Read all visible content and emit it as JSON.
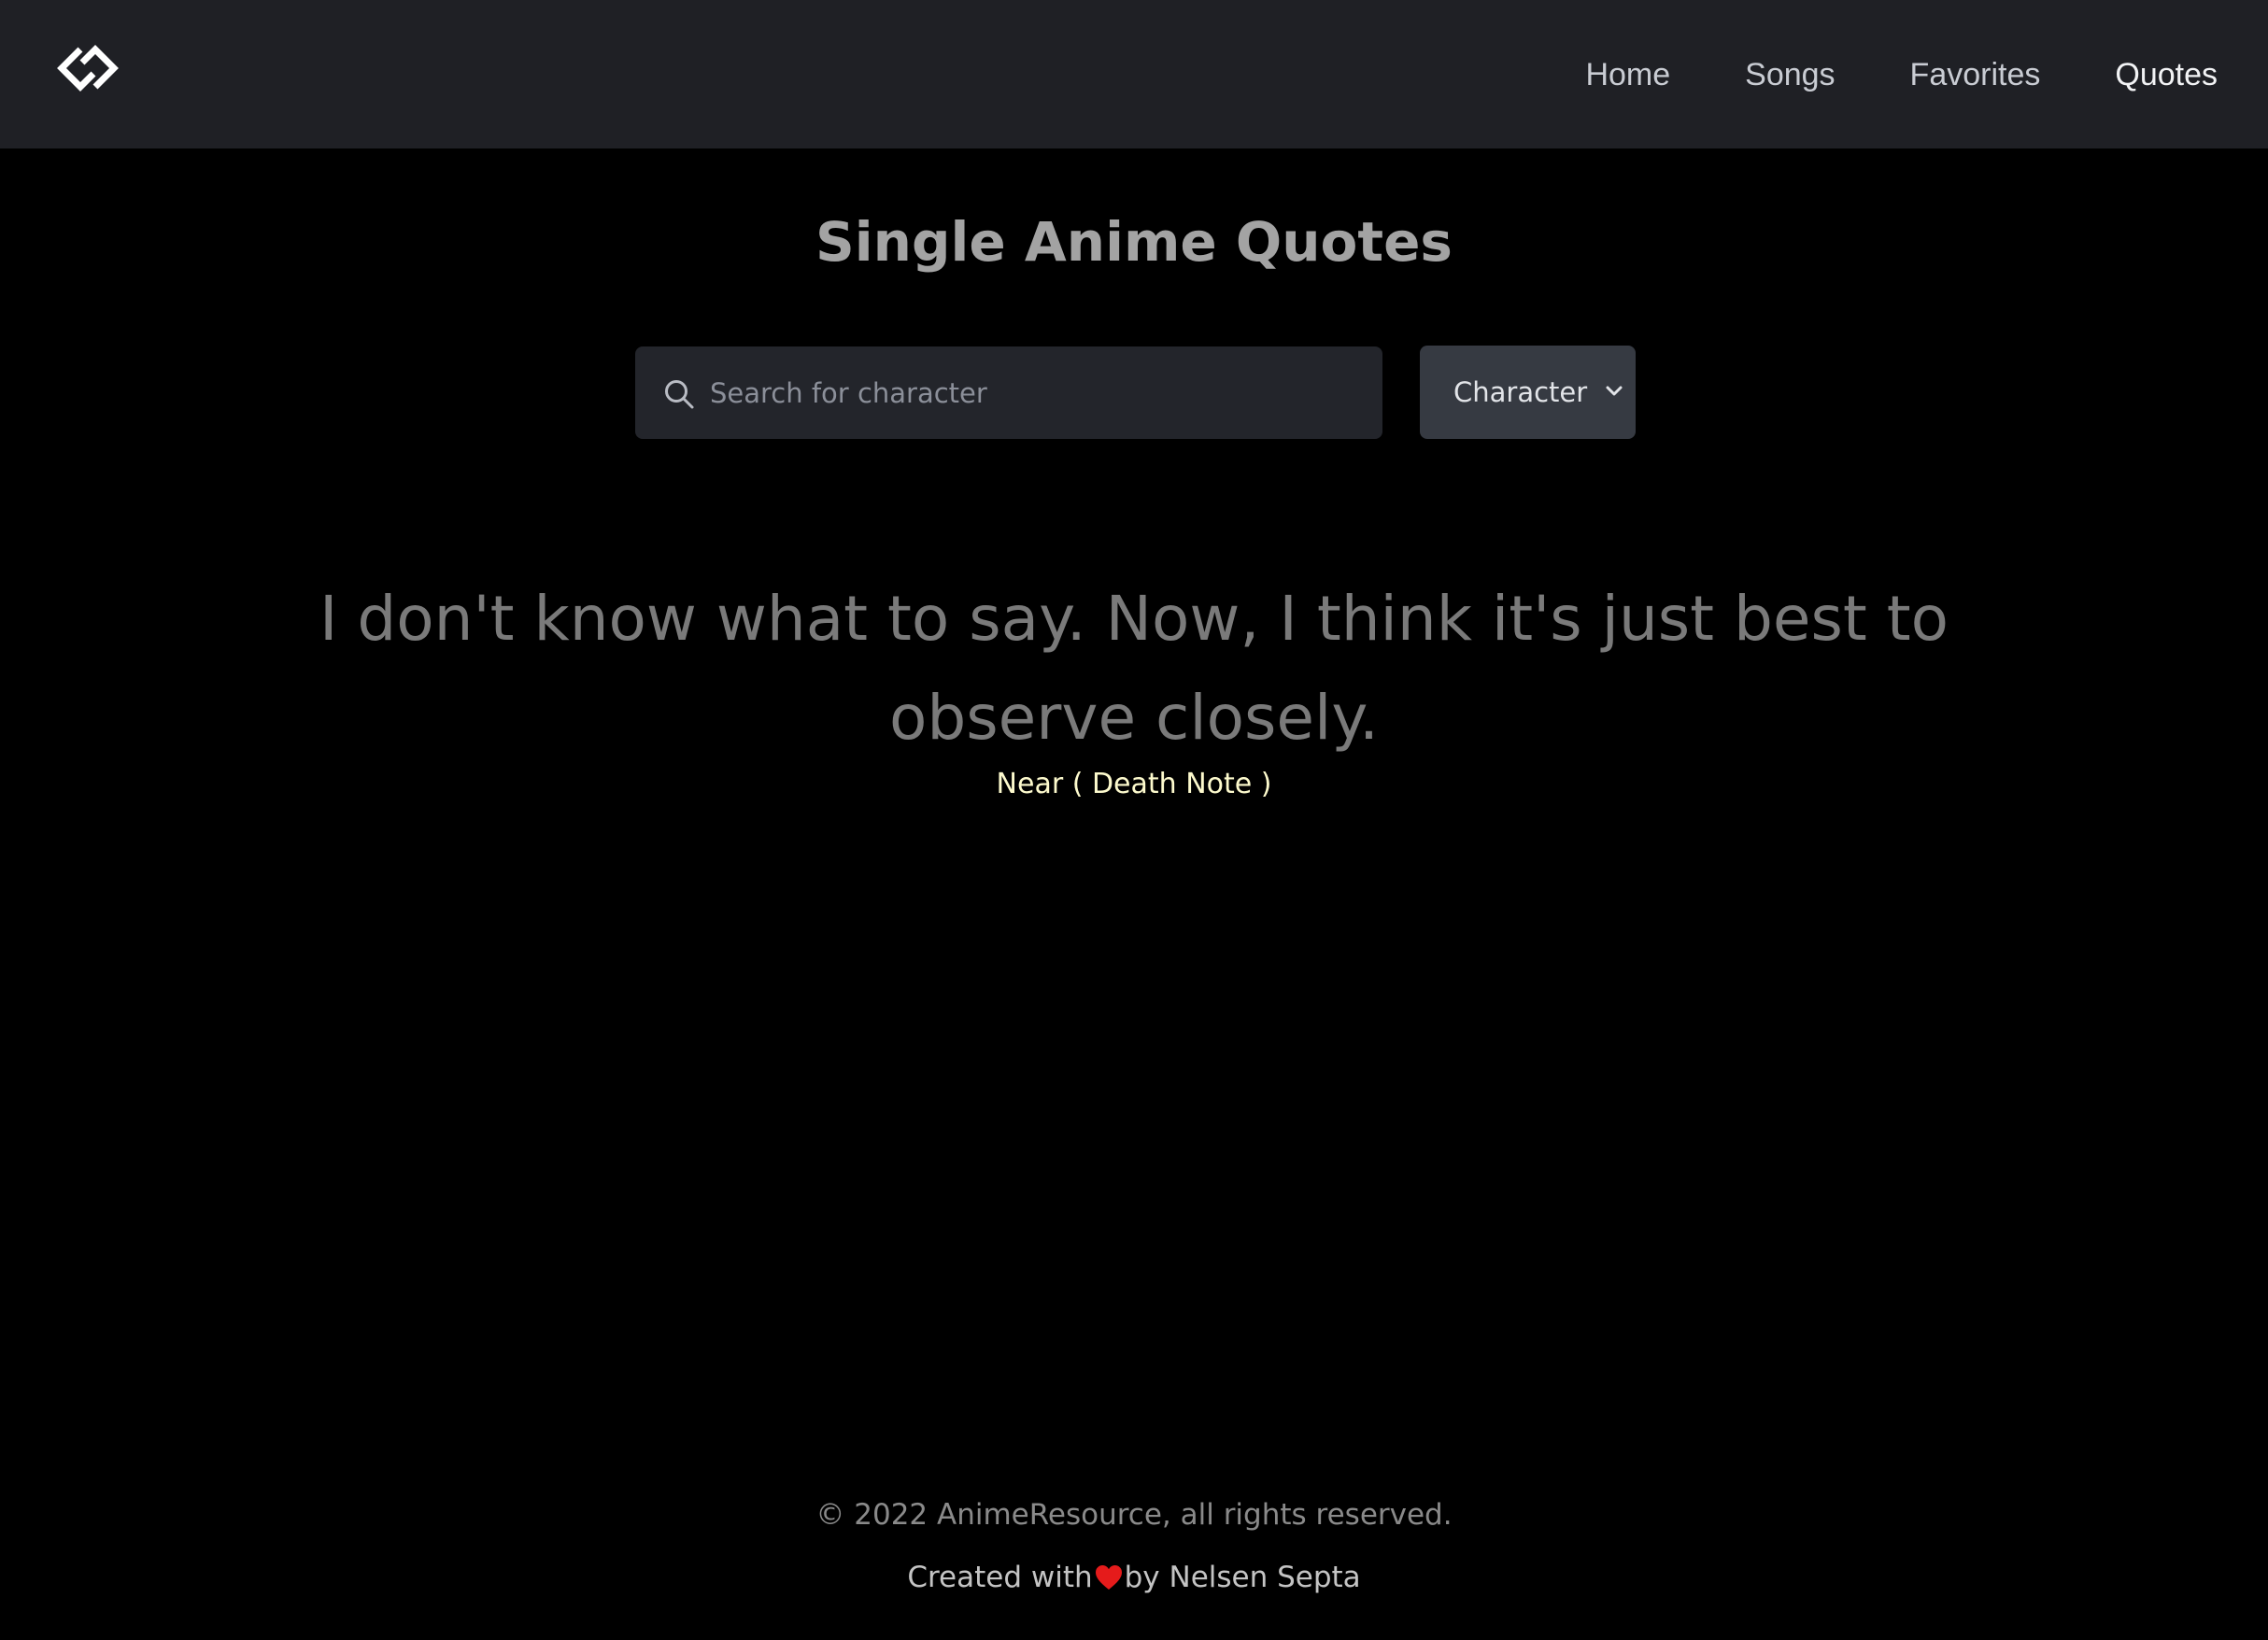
{
  "nav": {
    "logo_icon": "diamond-chain-logo-icon",
    "links": [
      {
        "label": "Home",
        "active": false
      },
      {
        "label": "Songs",
        "active": false
      },
      {
        "label": "Favorites",
        "active": false
      },
      {
        "label": "Quotes",
        "active": true
      }
    ]
  },
  "main": {
    "title": "Single Anime Quotes",
    "search": {
      "placeholder": "Search for character",
      "value": "",
      "icon": "search-icon"
    },
    "filter": {
      "selected": "Character",
      "icon": "chevron-down-icon"
    },
    "quote": {
      "text": "I don't know what to say. Now, I think it's just best to observe closely.",
      "attribution": "Near ( Death Note )"
    }
  },
  "footer": {
    "copyright": "© 2022 AnimeResource, all rights reserved.",
    "credit_prefix": "Created with",
    "credit_suffix": "by Nelsen Septa",
    "heart_icon": "heart-icon"
  },
  "colors": {
    "navbar_bg": "#1f2025",
    "page_bg": "#000000",
    "title": "#a3a3a3",
    "quote": "#7a7a7a",
    "attribution": "#fdfacd",
    "heart": "#e51b1b"
  }
}
